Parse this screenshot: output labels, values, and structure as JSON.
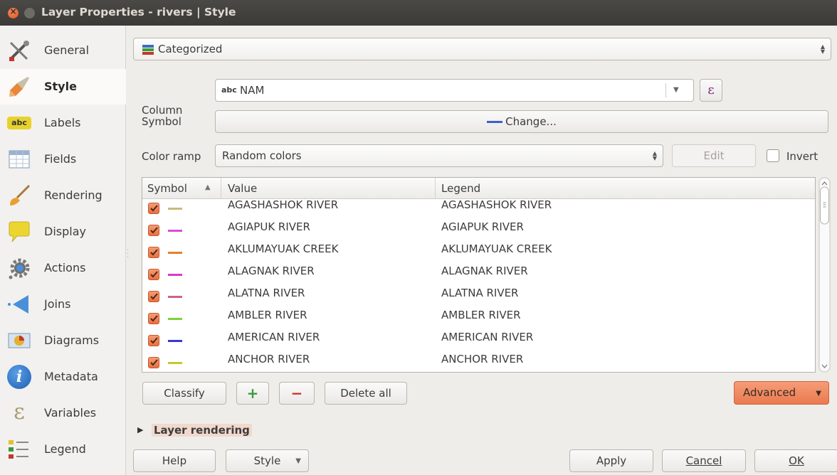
{
  "window": {
    "title": "Layer Properties - rivers | Style",
    "close_glyph": "×"
  },
  "sidebar": {
    "items": [
      {
        "label": "General"
      },
      {
        "label": "Style"
      },
      {
        "label": "Labels",
        "badge": "abc"
      },
      {
        "label": "Fields"
      },
      {
        "label": "Rendering"
      },
      {
        "label": "Display"
      },
      {
        "label": "Actions"
      },
      {
        "label": "Joins"
      },
      {
        "label": "Diagrams"
      },
      {
        "label": "Metadata",
        "badge": "i"
      },
      {
        "label": "Variables",
        "badge": "ε"
      },
      {
        "label": "Legend"
      }
    ]
  },
  "renderer": {
    "type": "Categorized"
  },
  "column": {
    "label": "Column",
    "type_tag": "abc",
    "value": "NAM",
    "expr_glyph": "ε"
  },
  "symbol": {
    "label": "Symbol",
    "button": "Change..."
  },
  "color_ramp": {
    "label": "Color ramp",
    "value": "Random colors",
    "edit": "Edit",
    "invert": "Invert"
  },
  "table": {
    "headers": [
      "Symbol",
      "Value",
      "Legend"
    ],
    "sort_glyph": "▲",
    "rows": [
      {
        "value": "AGASHASHOK RIVER",
        "legend": "AGASHASHOK RIVER",
        "color": "#c8bc78"
      },
      {
        "value": "AGIAPUK RIVER",
        "legend": "AGIAPUK RIVER",
        "color": "#d94fd2"
      },
      {
        "value": "AKLUMAYUAK CREEK",
        "legend": "AKLUMAYUAK CREEK",
        "color": "#e2822c"
      },
      {
        "value": "ALAGNAK RIVER",
        "legend": "ALAGNAK RIVER",
        "color": "#d83cc6"
      },
      {
        "value": "ALATNA RIVER",
        "legend": "ALATNA RIVER",
        "color": "#c86686"
      },
      {
        "value": "AMBLER RIVER",
        "legend": "AMBLER RIVER",
        "color": "#7ed23c"
      },
      {
        "value": "AMERICAN RIVER",
        "legend": "AMERICAN RIVER",
        "color": "#3a36d8"
      },
      {
        "value": "ANCHOR RIVER",
        "legend": "ANCHOR RIVER",
        "color": "#c8c82c"
      }
    ]
  },
  "buttons": {
    "classify": "Classify",
    "add_glyph": "+",
    "remove_glyph": "−",
    "delete_all": "Delete all",
    "advanced": "Advanced"
  },
  "layer_rendering": "Layer rendering",
  "footer": {
    "help": "Help",
    "style": "Style",
    "apply": "Apply",
    "cancel": "Cancel",
    "ok": "OK"
  },
  "colors": {
    "accent": "#ea7a4f",
    "titlebar": "#3b3a37",
    "close": "#e2521c"
  }
}
